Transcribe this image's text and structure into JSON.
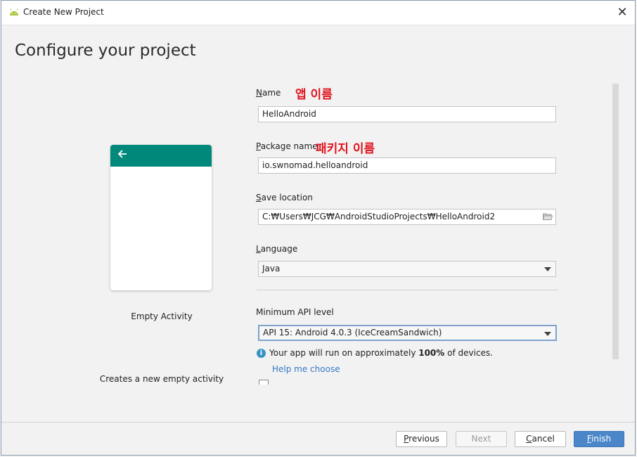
{
  "window": {
    "title": "Create New Project",
    "close_glyph": "✕"
  },
  "header": {
    "title": "Configure your project"
  },
  "template": {
    "back_glyph": "🡐",
    "label": "Empty Activity",
    "description": "Creates a new empty activity"
  },
  "form": {
    "name": {
      "label_u": "N",
      "label_rest": "ame",
      "value": "HelloAndroid",
      "annotation": "앱 이름"
    },
    "package": {
      "label_u": "P",
      "label_rest": "ackage name",
      "value": "io.swnomad.helloandroid",
      "annotation": "패키지 이름"
    },
    "save_location": {
      "label_u": "S",
      "label_rest": "ave location",
      "value": "C:₩Users₩JCG₩AndroidStudioProjects₩HelloAndroid2"
    },
    "language": {
      "label_u": "L",
      "label_rest": "anguage",
      "value": "Java"
    },
    "min_api": {
      "label": "Minimum API level",
      "value": "API 15: Android 4.0.3 (IceCreamSandwich)"
    },
    "info": {
      "prefix": "Your app will run on approximately ",
      "percent": "100%",
      "suffix": " of devices."
    },
    "help_link": "Help me choose"
  },
  "footer": {
    "previous": {
      "u": "P",
      "rest": "revious"
    },
    "next": "Next",
    "cancel": {
      "u": "C",
      "rest": "ancel"
    },
    "finish": {
      "u": "F",
      "rest": "inish"
    }
  },
  "colors": {
    "accent": "#00897b",
    "annotation": "#e0141e",
    "link": "#3478c5",
    "primary_button": "#4a86c8"
  }
}
